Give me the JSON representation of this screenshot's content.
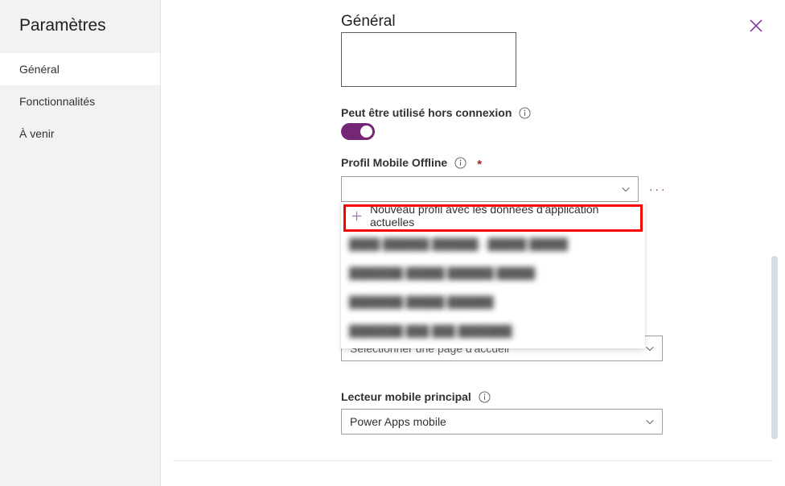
{
  "sidebar": {
    "title": "Paramètres",
    "items": [
      {
        "label": "Général",
        "selected": true
      },
      {
        "label": "Fonctionnalités",
        "selected": false
      },
      {
        "label": "À venir",
        "selected": false
      }
    ]
  },
  "header": {
    "title": "Général",
    "close_icon": "close-icon"
  },
  "main": {
    "description_textarea": {
      "value": "",
      "placeholder": ""
    },
    "offline_field": {
      "label": "Peut être utilisé hors connexion",
      "info_icon": "info-icon",
      "toggle_on": true
    },
    "profile_field": {
      "label": "Profil Mobile Offline",
      "info_icon": "info-icon",
      "required_marker": "*",
      "value": "",
      "chevron_icon": "chevron-down-icon",
      "more_button": "···"
    },
    "dropdown": {
      "new_profile_option": "Nouveau profil avec les données d'application actuelles",
      "plus_icon": "plus-icon",
      "options": [
        "████ ██████ ██████ - █████ █████",
        "███████ █████ ██████ █████",
        "███████ █████ ██████",
        "███████ ███ ███ ███████"
      ],
      "highlight_color": "#ff0000"
    },
    "homepage_field": {
      "value": "Sélectionner une page d'accueil",
      "chevron_icon": "chevron-down-icon"
    },
    "player_field": {
      "label": "Lecteur mobile principal",
      "info_icon": "info-icon",
      "value": "Power Apps mobile",
      "chevron_icon": "chevron-down-icon"
    }
  },
  "theme": {
    "accent": "#742774",
    "sidebar_bg": "#f3f2f1",
    "text": "#323130"
  }
}
